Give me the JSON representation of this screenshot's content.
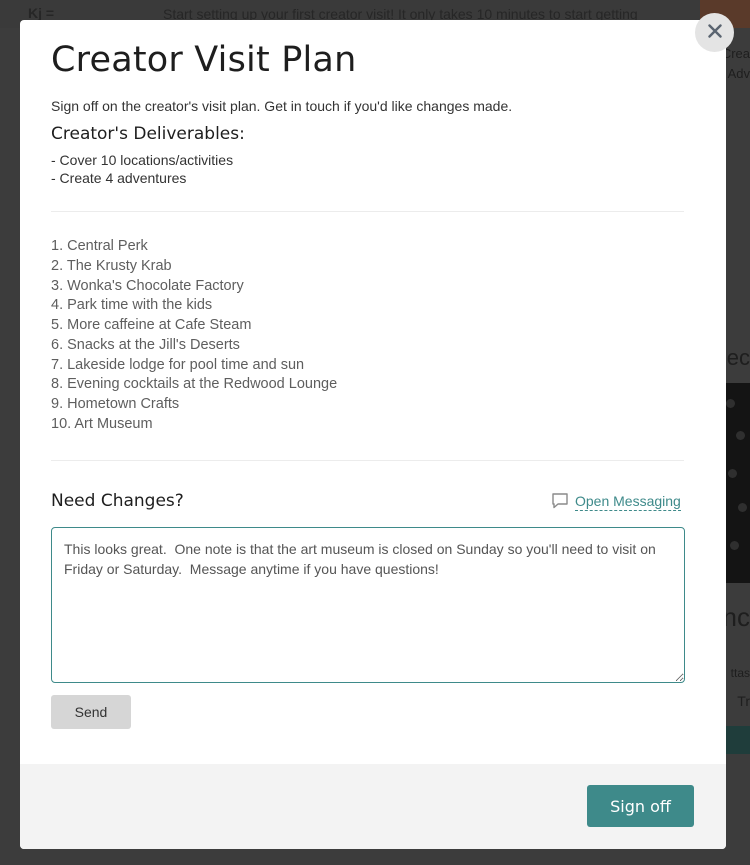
{
  "background": {
    "logo": "Kj =",
    "banner_text": "Start setting up your first creator visit! It only takes 10 minutes to start getting",
    "right_fragments": [
      "Crea",
      "Adv",
      "ec",
      "nc",
      "ttas",
      "Tr"
    ]
  },
  "modal": {
    "title": "Creator Visit Plan",
    "intro": "Sign off on the creator's visit plan. Get in touch if you'd like changes made.",
    "deliverables": {
      "heading": "Creator's Deliverables:",
      "items": [
        "- Cover 10 locations/activities",
        "- Create 4 adventures"
      ]
    },
    "plan_items": [
      "1. Central Perk",
      "2. The Krusty Krab",
      "3. Wonka's Chocolate Factory",
      "4. Park time with the kids",
      "5. More caffeine at Cafe Steam",
      "6. Snacks at the Jill's Deserts",
      "7. Lakeside lodge for pool time and sun",
      "8. Evening cocktails at the Redwood Lounge",
      "9. Hometown Crafts",
      "10. Art Museum"
    ],
    "changes": {
      "heading": "Need Changes?",
      "open_messaging_label": "Open Messaging",
      "message_value": "This looks great.  One note is that the art museum is closed on Sunday so you'll need to visit on Friday or Saturday.  Message anytime if you have questions!",
      "send_label": "Send"
    },
    "footer": {
      "signoff_label": "Sign off"
    }
  },
  "colors": {
    "accent": "#3e8a8a",
    "send_button": "#d6d6d6",
    "footer_bg": "#f3f3f3"
  },
  "icons": {
    "close": "close-icon",
    "messaging": "speech-bubble-icon"
  }
}
